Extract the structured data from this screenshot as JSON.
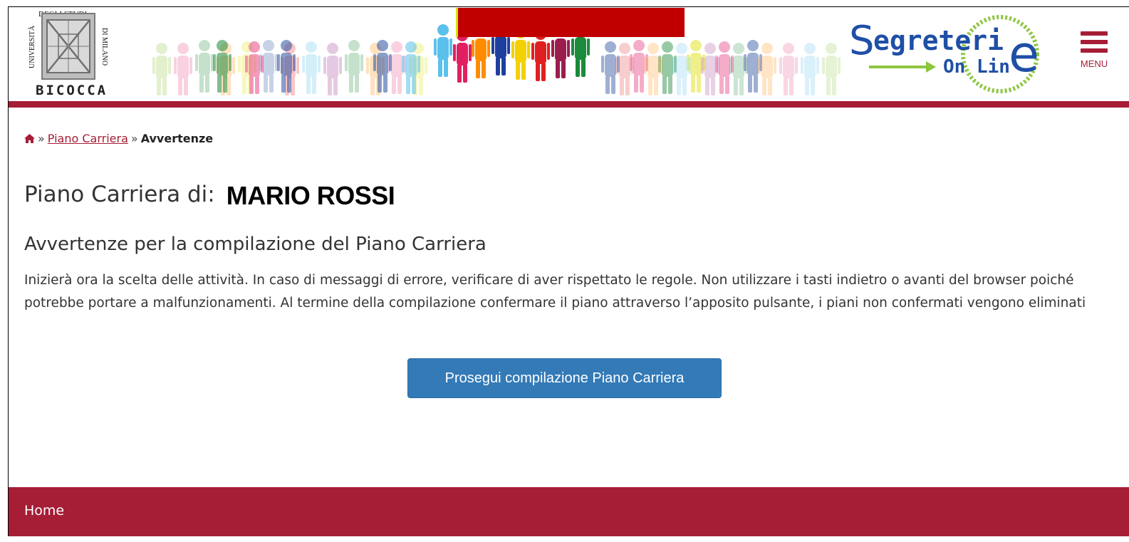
{
  "header": {
    "university": {
      "top_text": "DEGLI STUDI",
      "left_text": "UNIVERSITÀ",
      "right_text": "DI MILANO",
      "name": "BICOCCA"
    },
    "brand_logo": {
      "word1": "Segreterie",
      "word2": "On Line",
      "colors": {
        "blue": "#1f4fa6",
        "green": "#8dc63f"
      }
    },
    "menu_label": "MENU"
  },
  "breadcrumb": {
    "home_icon": "home-icon",
    "separator": "»",
    "link": "Piano Carriera",
    "current": "Avvertenze"
  },
  "page": {
    "title_prefix": "Piano Carriera di:",
    "student_name": "MARIO ROSSI",
    "subtitle": "Avvertenze per la compilazione del Piano Carriera",
    "paragraph": "Inizierà ora la scelta delle attività. In caso di messaggi di errore, verificare di aver rispettato le regole. Non utilizzare i tasti indietro o avanti del browser poiché potrebbe portare a malfunzionamenti. Al termine della compilazione confermare il piano attraverso l’apposito pulsante, i piani non confermati vengono eliminati",
    "continue_button": "Prosegui compilazione Piano Carriera"
  },
  "footer": {
    "home_link": "Home"
  },
  "colors": {
    "brand": "#a61d36",
    "button": "#337ab7",
    "redaction": "#c00000"
  }
}
